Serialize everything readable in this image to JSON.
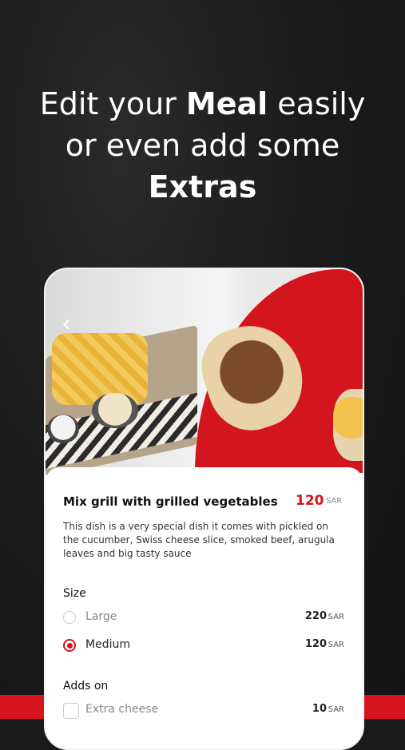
{
  "headline": {
    "line1_pre": "Edit your ",
    "line1_bold": "Meal",
    "line1_post": " easily",
    "line2": "or even add some",
    "line3_bold": "Extras"
  },
  "item": {
    "title": "Mix grill with grilled vegetables",
    "price": "120",
    "currency": "SAR",
    "description": "This dish is a very special dish it comes with pickled on the cucumber, Swiss cheese slice, smoked beef, arugula leaves and big tasty sauce"
  },
  "size": {
    "label": "Size",
    "options": [
      {
        "label": "Large",
        "price": "220",
        "currency": "SAR",
        "selected": false
      },
      {
        "label": "Medium",
        "price": "120",
        "currency": "SAR",
        "selected": true
      }
    ]
  },
  "addons": {
    "label": "Adds on",
    "options": [
      {
        "label": "Extra cheese",
        "price": "10",
        "currency": "SAR",
        "checked": false
      }
    ]
  },
  "icons": {
    "back": "chevron-left-icon"
  },
  "colors": {
    "accent": "#d3161d",
    "background": "#1a1a1a"
  }
}
